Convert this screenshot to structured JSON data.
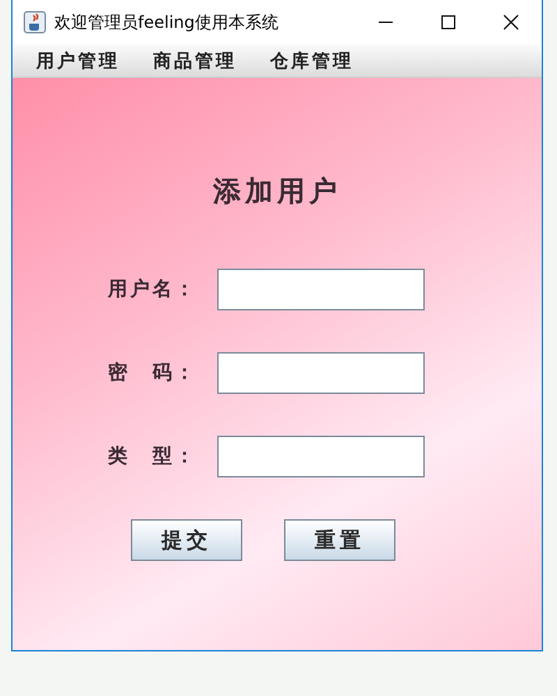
{
  "window": {
    "title": "欢迎管理员feeling使用本系统"
  },
  "menu": [
    {
      "label": "用户管理"
    },
    {
      "label": "商品管理"
    },
    {
      "label": "仓库管理"
    }
  ],
  "form": {
    "heading": "添加用户",
    "fields": [
      {
        "label": "用户名："
      },
      {
        "label": "密　码："
      },
      {
        "label": "类　型："
      }
    ],
    "buttons": [
      {
        "label": "提交"
      },
      {
        "label": "重置"
      }
    ]
  }
}
